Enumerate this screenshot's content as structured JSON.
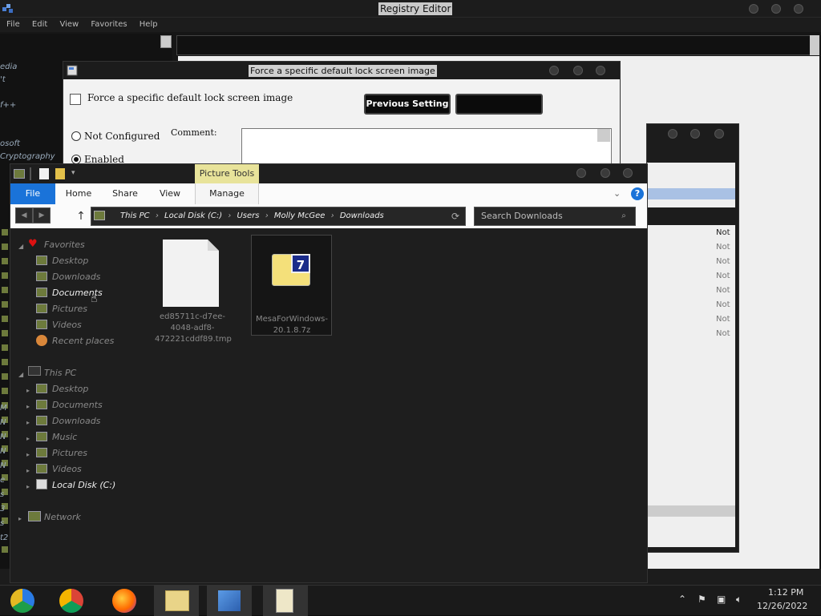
{
  "regedit": {
    "title": "Registry Editor",
    "menu": [
      "File",
      "Edit",
      "View",
      "Favorites",
      "Help"
    ],
    "tree_fragments": [
      "edia",
      "'t",
      "f++",
      "osoft",
      "Cryptography"
    ],
    "tree_left_glyphs": [
      "M",
      "N",
      "N",
      "N",
      "N",
      "e",
      "s",
      "3",
      "s",
      "t2"
    ]
  },
  "policy_dialog": {
    "title": "Force a specific default lock screen image",
    "heading": "Force a specific default lock screen image",
    "previous_button": "Previous Setting",
    "next_button": "",
    "radio_not_configured": "Not Configured",
    "radio_enabled": "Enabled",
    "comment_label": "Comment:"
  },
  "bg_window": {
    "cells": [
      "Not",
      "Not",
      "Not",
      "Not",
      "Not",
      "Not",
      "Not",
      "Not"
    ]
  },
  "explorer": {
    "contextual_tab": "Picture Tools",
    "tabs": [
      "File",
      "Home",
      "Share",
      "View",
      "Manage"
    ],
    "help_label": "?",
    "address": {
      "segments": [
        "This PC",
        "Local Disk (C:)",
        "Users",
        "Molly McGee",
        "Downloads"
      ],
      "separator": "›"
    },
    "search_placeholder": "Search Downloads",
    "nav": {
      "favorites_label": "Favorites",
      "favorites": [
        "Desktop",
        "Downloads",
        "Documents",
        "Pictures",
        "Videos",
        "Recent places"
      ],
      "thispc_label": "This PC",
      "thispc": [
        "Desktop",
        "Documents",
        "Downloads",
        "Music",
        "Pictures",
        "Videos",
        "Local Disk (C:)"
      ],
      "network_label": "Network"
    },
    "files": [
      {
        "name": "ed85711c-d7ee-4048-adf8-472221cddf89.tmp",
        "icon": "blank-file-icon"
      },
      {
        "name": "MesaForWindows-20.1.8.7z",
        "icon": "7zip-archive-icon"
      }
    ]
  },
  "taskbar": {
    "apps": [
      "chromium-icon",
      "chrome-icon",
      "firefox-icon",
      "file-explorer-icon",
      "regedit-icon",
      "notepad-icon"
    ],
    "time": "1:12 PM",
    "date": "12/26/2022"
  }
}
